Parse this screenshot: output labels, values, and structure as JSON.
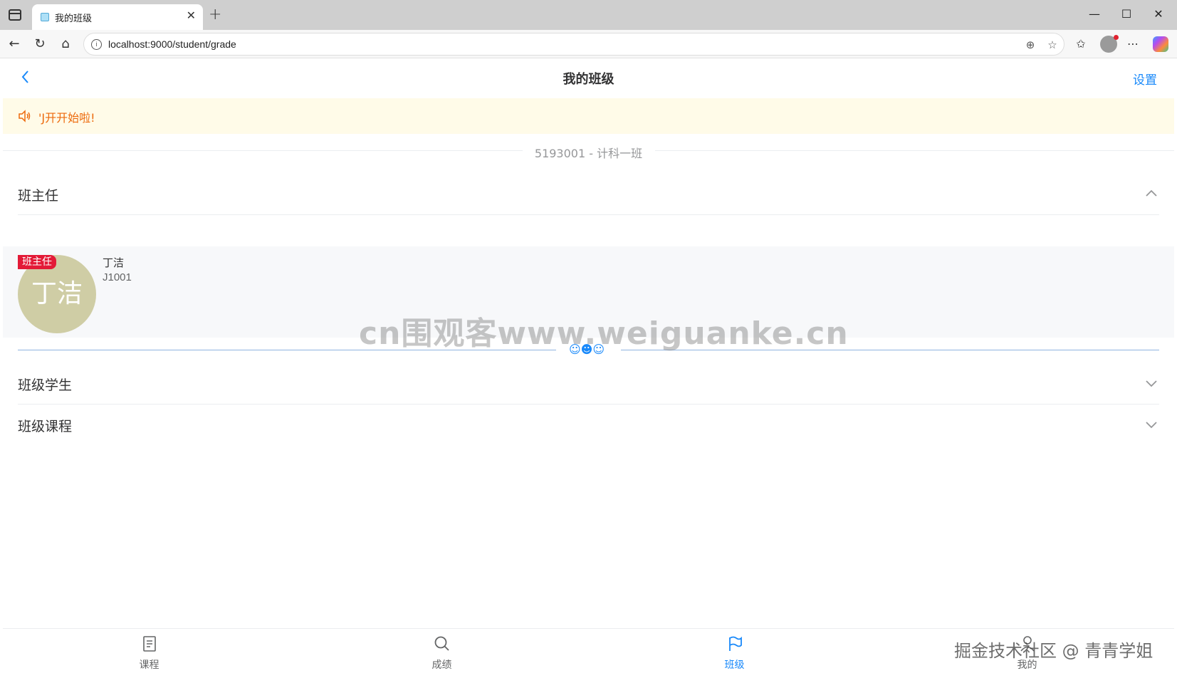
{
  "browser": {
    "tab_title": "我的班级",
    "url": "localhost:9000/student/grade"
  },
  "app": {
    "nav_title": "我的班级",
    "nav_right": "设置",
    "notice_text": "'J开开始啦!",
    "class_divider": "5193001 - 计科一班",
    "sections": {
      "teacher": "班主任",
      "students": "班级学生",
      "courses": "班级课程"
    },
    "teacher": {
      "tag": "班主任",
      "avatar_text": "丁洁",
      "name": "丁洁",
      "id": "J1001"
    },
    "emoji_divider": "☺☻☺",
    "watermark": "cn围观客www.weiguanke.cn",
    "tabbar": [
      {
        "label": "课程",
        "icon": "document-icon",
        "active": false
      },
      {
        "label": "成绩",
        "icon": "search-icon",
        "active": false
      },
      {
        "label": "班级",
        "icon": "flag-icon",
        "active": true
      },
      {
        "label": "我的",
        "icon": "user-icon",
        "active": false
      }
    ],
    "accent_color": "#1989fa",
    "notice_color": "#ed6a0c",
    "tag_color": "#e31a37"
  },
  "site_watermark": "掘金技术社区 @ 青青学姐"
}
